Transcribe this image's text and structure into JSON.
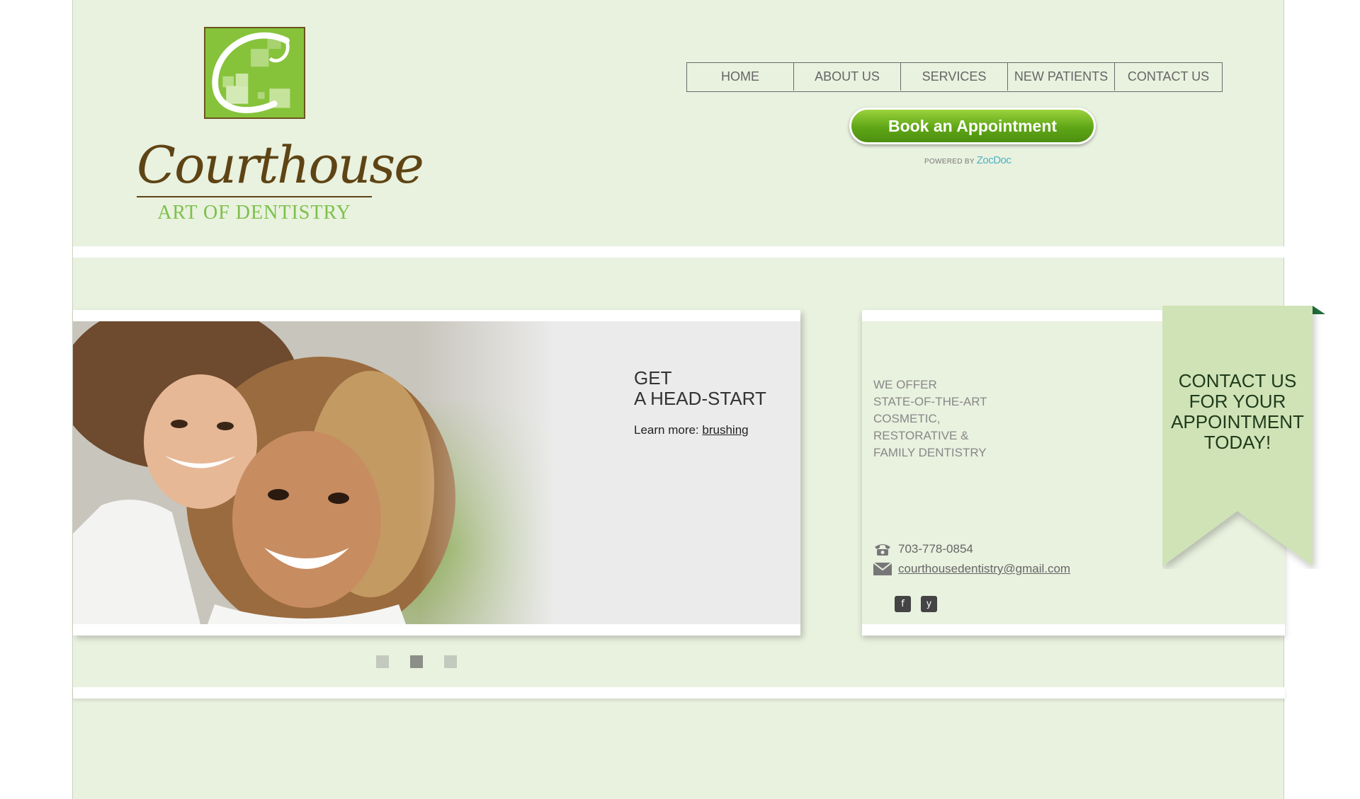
{
  "brand": {
    "name": "Courthouse",
    "tagline": "ART OF DENTISTRY"
  },
  "nav": {
    "items": [
      "HOME",
      "ABOUT US",
      "SERVICES",
      "NEW PATIENTS",
      "CONTACT US"
    ]
  },
  "booking": {
    "button_label": "Book an Appointment",
    "powered_by": "POWERED BY",
    "provider": "ZocDoc"
  },
  "slider": {
    "headline_line1": "GET",
    "headline_line2": "A HEAD-START",
    "learn_prefix": "Learn more:",
    "learn_link": "brushing",
    "slide_count": 3,
    "active_slide": 2
  },
  "contact": {
    "offer_lines": [
      "WE OFFER",
      "STATE-OF-THE-ART",
      "COSMETIC,",
      "RESTORATIVE &",
      "FAMILY DENTISTRY"
    ],
    "phone": "703-778-0854",
    "email": "courthousedentistry@gmail.com",
    "social": [
      {
        "icon": "facebook-icon",
        "glyph": "f"
      },
      {
        "icon": "yelp-icon",
        "glyph": "y"
      }
    ],
    "ribbon_lines": [
      "CONTACT US",
      "FOR YOUR",
      "APPOINTMENT",
      "TODAY!"
    ]
  },
  "colors": {
    "page_bg": "#e9f1df",
    "accent_green": "#7cc14a",
    "brown": "#5e4414",
    "ribbon": "#cfe3b6"
  }
}
